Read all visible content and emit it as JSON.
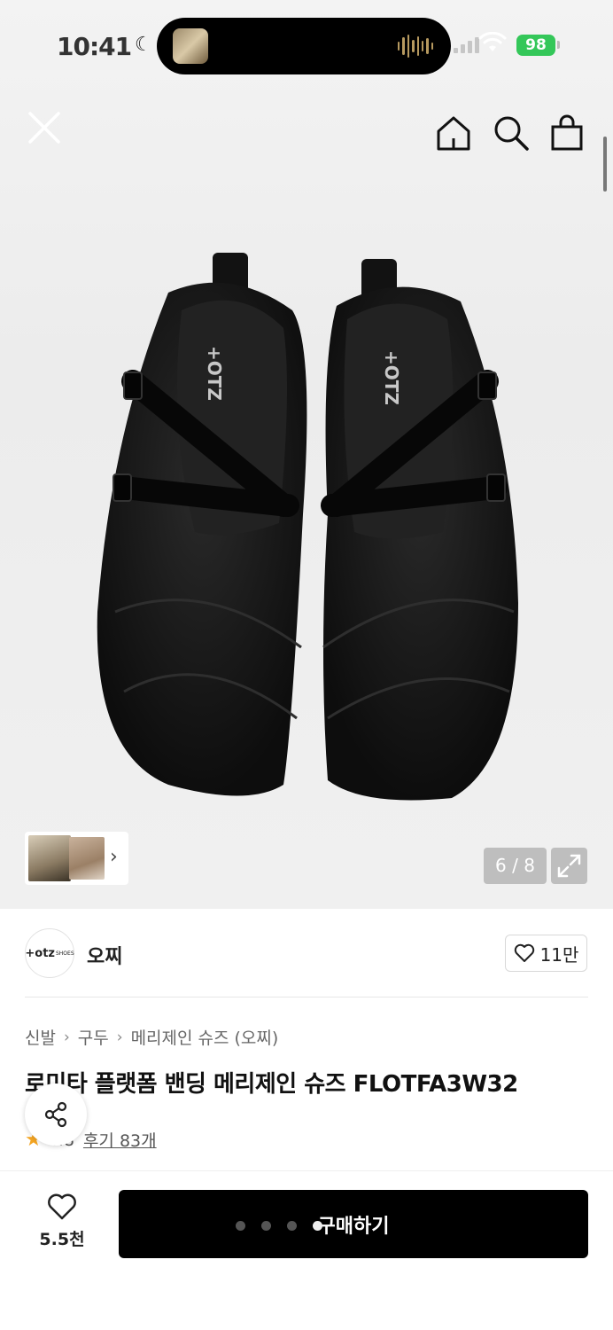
{
  "status_bar": {
    "time": "10:41",
    "battery": "98"
  },
  "gallery": {
    "page_indicator": "6 / 8",
    "logo_text": "+OTZ"
  },
  "brand": {
    "name": "오찌",
    "logo_text": "+otz",
    "logo_sub": "SHOES",
    "like_count": "11만"
  },
  "breadcrumb": {
    "items": [
      "신발",
      "구두",
      "메리제인 슈즈 (오찌)"
    ]
  },
  "product": {
    "title": "로미타 플랫폼 밴딩 메리제인 슈즈 FLOTFA3W32",
    "rating": "4.8",
    "review_link": "후기 83개"
  },
  "bottom_bar": {
    "wish_count": "5.5천",
    "buy_label": "구매하기"
  },
  "colors": {
    "accent": "#000000",
    "star": "#f5a623",
    "battery": "#34c759"
  }
}
